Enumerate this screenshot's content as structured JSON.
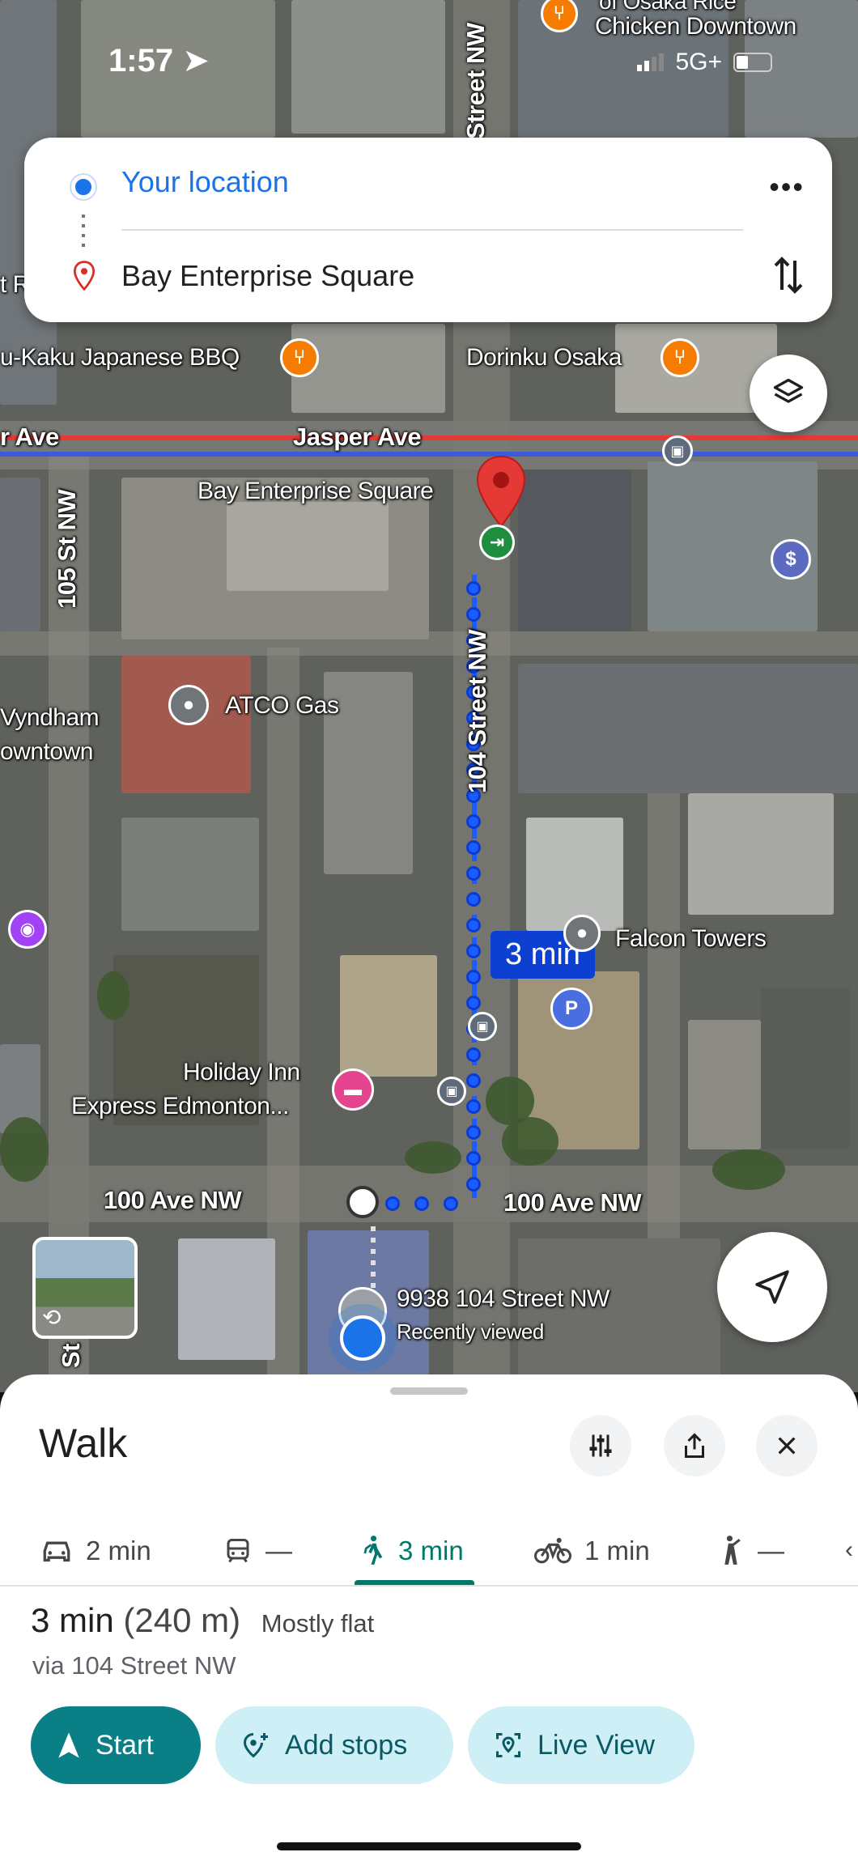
{
  "status_bar": {
    "time": "1:57",
    "network": "5G+"
  },
  "directions": {
    "from": "Your location",
    "to": "Bay Enterprise Square"
  },
  "map": {
    "streets": {
      "jasper_ave": "Jasper Ave",
      "jasper_ave_left": "r Ave",
      "street_104_top": "Street NW",
      "street_104": "104 Street NW",
      "street_105": "105 St NW",
      "ave_100_left": "100 Ave NW",
      "ave_100_right": "100 Ave NW",
      "st_bottom": "St"
    },
    "pois": {
      "chicken": "Chicken Downtown",
      "chicken_top": "of Osaka Rice",
      "bbq": "u-Kaku Japanese BBQ",
      "dorinku": "Dorinku Osaka",
      "bay": "Bay Enterprise Square",
      "atco": "ATCO Gas",
      "wyndham_1": "Vyndham",
      "wyndham_2": "owntown",
      "falcon": "Falcon Towers",
      "holiday_1": "Holiday Inn",
      "holiday_2": "Express Edmonton...",
      "address": "9938 104 Street NW",
      "recently": "Recently viewed",
      "left_fragment": "t R"
    },
    "route_badge": "3 min",
    "parking_letter": "P",
    "dollar_sign": "$"
  },
  "sheet": {
    "title": "Walk",
    "modes": [
      {
        "icon": "car-icon",
        "label": "2 min"
      },
      {
        "icon": "transit-icon",
        "label": "—"
      },
      {
        "icon": "walk-icon",
        "label": "3 min",
        "active": true
      },
      {
        "icon": "bike-icon",
        "label": "1 min"
      },
      {
        "icon": "rideshare-icon",
        "label": "—"
      }
    ],
    "summary": {
      "time": "3 min",
      "distance": "(240 m)",
      "terrain": "Mostly flat"
    },
    "via": "via 104 Street NW",
    "buttons": {
      "start": "Start",
      "add_stops": "Add stops",
      "live_view": "Live View"
    }
  },
  "colors": {
    "accent": "#0b7f86",
    "route": "#1a5cff",
    "link_blue": "#1a73e8",
    "pin_red": "#d93025"
  }
}
